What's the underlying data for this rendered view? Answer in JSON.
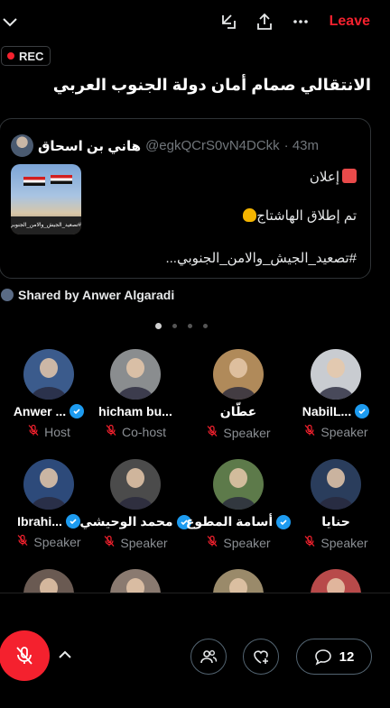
{
  "header": {
    "leave_label": "Leave",
    "rec_label": "REC",
    "icons": [
      "chevron-down-icon",
      "minimize-icon",
      "share-icon",
      "more-icon"
    ]
  },
  "space": {
    "title": "الانتقالي صمام أمان دولة الجنوب العربي"
  },
  "tweet": {
    "author_name": "هاني بن اسحاق",
    "handle": "@egkQCrS0vN4DCkk",
    "time": "· 43m",
    "lines": [
      "إعلان",
      "تم إطلاق الهاشتاج",
      "#تصعيد_الجيش_والامن_الجنوبي..."
    ],
    "image_caption": "#تصعيد_الجيش_والامن_الجنوبي"
  },
  "shared_by": "Shared by Anwer Algaradi",
  "pagination": {
    "count": 4,
    "active": 0
  },
  "participants": [
    {
      "name": "Anwer ...",
      "role": "Host",
      "verified": true,
      "color": "#3b5b8c"
    },
    {
      "name": "hicham bu...",
      "role": "Co-host",
      "verified": false,
      "color": "#8a8d8f"
    },
    {
      "name": "عطّان",
      "role": "Speaker",
      "verified": false,
      "color": "#b08a5a"
    },
    {
      "name": "NabilL...",
      "role": "Speaker",
      "verified": true,
      "color": "#c9ccd1"
    },
    {
      "name": "Ibrahi...",
      "role": "Speaker",
      "verified": true,
      "color": "#2d4a7a"
    },
    {
      "name": "محمد الوحيشي",
      "role": "Speaker",
      "verified": true,
      "color": "#4b4b4b"
    },
    {
      "name": "أسامة المطوع",
      "role": "Speaker",
      "verified": true,
      "color": "#5d7a4a"
    },
    {
      "name": "حنايا",
      "role": "Speaker",
      "verified": false,
      "color": "#2a3d5c"
    },
    {
      "name": "",
      "role": "",
      "verified": false,
      "color": "#6a5a52"
    },
    {
      "name": "",
      "role": "",
      "verified": false,
      "color": "#8a7a70"
    },
    {
      "name": "",
      "role": "",
      "verified": false,
      "color": "#9a8a6a"
    },
    {
      "name": "",
      "role": "",
      "verified": false,
      "color": "#b84a4a"
    }
  ],
  "footer": {
    "reply_count": "12"
  },
  "colors": {
    "accent": "#f4212e",
    "verified": "#1d9bf0"
  }
}
